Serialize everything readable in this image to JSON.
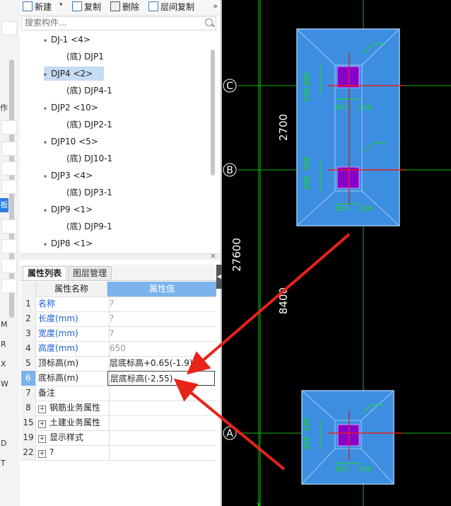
{
  "toolbar": {
    "new_label": "新建",
    "copy_label": "复制",
    "delete_label": "删除",
    "layer_copy_label": "层间复制",
    "more_label": "»"
  },
  "search": {
    "placeholder": "搜索构件..."
  },
  "tree": {
    "items": [
      {
        "label": "DJ-1 <4>",
        "level": 0,
        "expanded": true
      },
      {
        "label": "(底) DJP1",
        "level": 1
      },
      {
        "label": "DJP4 <2>",
        "level": 0,
        "expanded": true,
        "selected": true
      },
      {
        "label": "(底) DJP4-1",
        "level": 1
      },
      {
        "label": "DJP2 <10>",
        "level": 0,
        "expanded": true
      },
      {
        "label": "(底) DJP2-1",
        "level": 1
      },
      {
        "label": "DJP10 <5>",
        "level": 0,
        "expanded": true
      },
      {
        "label": "(底) DJ10-1",
        "level": 1
      },
      {
        "label": "DJP3 <4>",
        "level": 0,
        "expanded": true
      },
      {
        "label": "(底) DJP3-1",
        "level": 1
      },
      {
        "label": "DJP9 <1>",
        "level": 0,
        "expanded": true
      },
      {
        "label": "(底) DJP9-1",
        "level": 1
      },
      {
        "label": "DJP8 <1>",
        "level": 0,
        "expanded": true
      }
    ]
  },
  "panel_close": "×",
  "tabs": [
    {
      "label": "属性列表",
      "active": true
    },
    {
      "label": "图层管理",
      "active": false
    }
  ],
  "props": {
    "header": {
      "name": "属性名称",
      "value": "属性值"
    },
    "rows": [
      {
        "num": "1",
        "name": "名称",
        "value": "?",
        "name_blue": true,
        "value_gray": true
      },
      {
        "num": "2",
        "name": "长度(mm)",
        "value": "?",
        "name_blue": true,
        "value_gray": true
      },
      {
        "num": "3",
        "name": "宽度(mm)",
        "value": "?",
        "name_blue": true,
        "value_gray": true
      },
      {
        "num": "4",
        "name": "高度(mm)",
        "value": "650",
        "name_blue": true,
        "value_gray": true
      },
      {
        "num": "5",
        "name": "顶标高(m)",
        "value": "层底标高+0.65(-1.9)"
      },
      {
        "num": "6",
        "name": "底标高(m)",
        "value": "层底标高(-2.55)",
        "highlight": true
      },
      {
        "num": "7",
        "name": "备注",
        "value": ""
      },
      {
        "num": "8",
        "name": "钢筋业务属性",
        "value": "",
        "expandable": true
      },
      {
        "num": "15",
        "name": "土建业务属性",
        "value": "",
        "expandable": true
      },
      {
        "num": "19",
        "name": "显示样式",
        "value": "",
        "expandable": true
      },
      {
        "num": "22",
        "name": "?",
        "value": "",
        "expandable": true
      }
    ]
  },
  "left_strip": {
    "labels": [
      "作",
      "板",
      "M",
      "R",
      "X",
      "W",
      "D",
      "T"
    ]
  },
  "cad": {
    "axis_c": "C",
    "axis_b": "B",
    "axis_a": "A",
    "dim_2700": "2700",
    "dim_27600": "27600",
    "dim_8400": "8400",
    "dim_600a": "600",
    "dim_100a": "100",
    "dim_500a": "500",
    "dim_200a": "200",
    "dim_100b": "100",
    "dim_600b": "600",
    "dim_500b": "500",
    "dim_200b": "200",
    "dim_100c": "100",
    "dim_200c": "200",
    "dim_500c": "500",
    "dim_200d": "200"
  },
  "colors": {
    "footing_fill": "#3d8ee0",
    "column_fill": "#8a00c8",
    "grid_green": "#18b418",
    "axis_red": "#e02020",
    "annotation_red": "#e8231a",
    "header_blue": "#7bb3ec"
  }
}
